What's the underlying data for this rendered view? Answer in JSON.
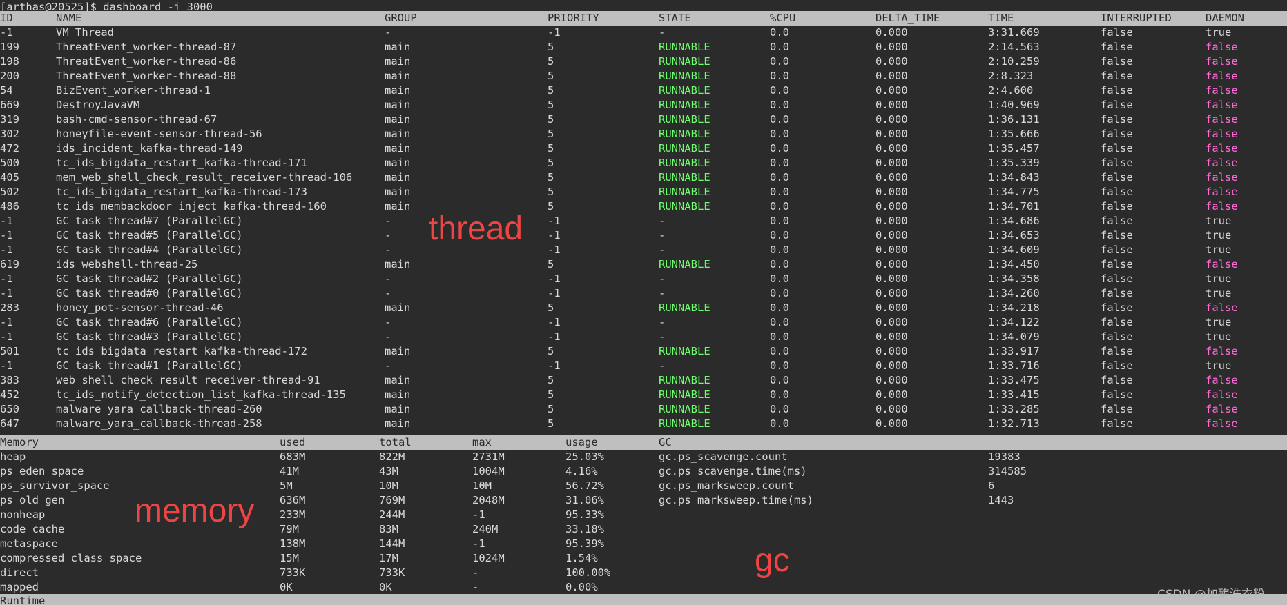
{
  "terminal": {
    "prompt": "[arthas@20525]$ dashboard -i 3000"
  },
  "thread_table": {
    "columns": [
      "ID",
      "NAME",
      "GROUP",
      "PRIORITY",
      "STATE",
      "%CPU",
      "DELTA_TIME",
      "TIME",
      "INTERRUPTED",
      "DAEMON"
    ],
    "rows": [
      [
        "-1",
        "VM Thread",
        "-",
        "-1",
        "-",
        "0.0",
        "0.000",
        "3:31.669",
        "false",
        "true"
      ],
      [
        "199",
        "ThreatEvent_worker-thread-87",
        "main",
        "5",
        "RUNNABLE",
        "0.0",
        "0.000",
        "2:14.563",
        "false",
        "false"
      ],
      [
        "198",
        "ThreatEvent_worker-thread-86",
        "main",
        "5",
        "RUNNABLE",
        "0.0",
        "0.000",
        "2:10.259",
        "false",
        "false"
      ],
      [
        "200",
        "ThreatEvent_worker-thread-88",
        "main",
        "5",
        "RUNNABLE",
        "0.0",
        "0.000",
        "2:8.323",
        "false",
        "false"
      ],
      [
        "54",
        "BizEvent_worker-thread-1",
        "main",
        "5",
        "RUNNABLE",
        "0.0",
        "0.000",
        "2:4.600",
        "false",
        "false"
      ],
      [
        "669",
        "DestroyJavaVM",
        "main",
        "5",
        "RUNNABLE",
        "0.0",
        "0.000",
        "1:40.969",
        "false",
        "false"
      ],
      [
        "319",
        "bash-cmd-sensor-thread-67",
        "main",
        "5",
        "RUNNABLE",
        "0.0",
        "0.000",
        "1:36.131",
        "false",
        "false"
      ],
      [
        "302",
        "honeyfile-event-sensor-thread-56",
        "main",
        "5",
        "RUNNABLE",
        "0.0",
        "0.000",
        "1:35.666",
        "false",
        "false"
      ],
      [
        "472",
        "ids_incident_kafka-thread-149",
        "main",
        "5",
        "RUNNABLE",
        "0.0",
        "0.000",
        "1:35.457",
        "false",
        "false"
      ],
      [
        "500",
        "tc_ids_bigdata_restart_kafka-thread-171",
        "main",
        "5",
        "RUNNABLE",
        "0.0",
        "0.000",
        "1:35.339",
        "false",
        "false"
      ],
      [
        "405",
        "mem_web_shell_check_result_receiver-thread-106",
        "main",
        "5",
        "RUNNABLE",
        "0.0",
        "0.000",
        "1:34.843",
        "false",
        "false"
      ],
      [
        "502",
        "tc_ids_bigdata_restart_kafka-thread-173",
        "main",
        "5",
        "RUNNABLE",
        "0.0",
        "0.000",
        "1:34.775",
        "false",
        "false"
      ],
      [
        "486",
        "tc_ids_membackdoor_inject_kafka-thread-160",
        "main",
        "5",
        "RUNNABLE",
        "0.0",
        "0.000",
        "1:34.701",
        "false",
        "false"
      ],
      [
        "-1",
        "GC task thread#7 (ParallelGC)",
        "-",
        "-1",
        "-",
        "0.0",
        "0.000",
        "1:34.686",
        "false",
        "true"
      ],
      [
        "-1",
        "GC task thread#5 (ParallelGC)",
        "-",
        "-1",
        "-",
        "0.0",
        "0.000",
        "1:34.653",
        "false",
        "true"
      ],
      [
        "-1",
        "GC task thread#4 (ParallelGC)",
        "-",
        "-1",
        "-",
        "0.0",
        "0.000",
        "1:34.609",
        "false",
        "true"
      ],
      [
        "619",
        "ids_webshell-thread-25",
        "main",
        "5",
        "RUNNABLE",
        "0.0",
        "0.000",
        "1:34.450",
        "false",
        "false"
      ],
      [
        "-1",
        "GC task thread#2 (ParallelGC)",
        "-",
        "-1",
        "-",
        "0.0",
        "0.000",
        "1:34.358",
        "false",
        "true"
      ],
      [
        "-1",
        "GC task thread#0 (ParallelGC)",
        "-",
        "-1",
        "-",
        "0.0",
        "0.000",
        "1:34.260",
        "false",
        "true"
      ],
      [
        "283",
        "honey_pot-sensor-thread-46",
        "main",
        "5",
        "RUNNABLE",
        "0.0",
        "0.000",
        "1:34.218",
        "false",
        "false"
      ],
      [
        "-1",
        "GC task thread#6 (ParallelGC)",
        "-",
        "-1",
        "-",
        "0.0",
        "0.000",
        "1:34.122",
        "false",
        "true"
      ],
      [
        "-1",
        "GC task thread#3 (ParallelGC)",
        "-",
        "-1",
        "-",
        "0.0",
        "0.000",
        "1:34.079",
        "false",
        "true"
      ],
      [
        "501",
        "tc_ids_bigdata_restart_kafka-thread-172",
        "main",
        "5",
        "RUNNABLE",
        "0.0",
        "0.000",
        "1:33.917",
        "false",
        "false"
      ],
      [
        "-1",
        "GC task thread#1 (ParallelGC)",
        "-",
        "-1",
        "-",
        "0.0",
        "0.000",
        "1:33.716",
        "false",
        "true"
      ],
      [
        "383",
        "web_shell_check_result_receiver-thread-91",
        "main",
        "5",
        "RUNNABLE",
        "0.0",
        "0.000",
        "1:33.475",
        "false",
        "false"
      ],
      [
        "452",
        "tc_ids_notify_detection_list_kafka-thread-135",
        "main",
        "5",
        "RUNNABLE",
        "0.0",
        "0.000",
        "1:33.415",
        "false",
        "false"
      ],
      [
        "650",
        "malware_yara_callback-thread-260",
        "main",
        "5",
        "RUNNABLE",
        "0.0",
        "0.000",
        "1:33.285",
        "false",
        "false"
      ],
      [
        "647",
        "malware_yara_callback-thread-258",
        "main",
        "5",
        "RUNNABLE",
        "0.0",
        "0.000",
        "1:32.713",
        "false",
        "false"
      ]
    ]
  },
  "memory_table": {
    "columns": [
      "Memory",
      "used",
      "total",
      "max",
      "usage"
    ],
    "rows": [
      [
        "heap",
        "683M",
        "822M",
        "2731M",
        "25.03%"
      ],
      [
        "ps_eden_space",
        "41M",
        "43M",
        "1004M",
        "4.16%"
      ],
      [
        "ps_survivor_space",
        "5M",
        "10M",
        "10M",
        "56.72%"
      ],
      [
        "ps_old_gen",
        "636M",
        "769M",
        "2048M",
        "31.06%"
      ],
      [
        "nonheap",
        "233M",
        "244M",
        "-1",
        "95.33%"
      ],
      [
        "code_cache",
        "79M",
        "83M",
        "240M",
        "33.18%"
      ],
      [
        "metaspace",
        "138M",
        "144M",
        "-1",
        "95.39%"
      ],
      [
        "compressed_class_space",
        "15M",
        "17M",
        "1024M",
        "1.54%"
      ],
      [
        "direct",
        "733K",
        "733K",
        "-",
        "100.00%"
      ],
      [
        "mapped",
        "0K",
        "0K",
        "-",
        "0.00%"
      ]
    ]
  },
  "gc_table": {
    "header": "GC",
    "rows": [
      [
        "gc.ps_scavenge.count",
        "19383"
      ],
      [
        "gc.ps_scavenge.time(ms)",
        "314585"
      ],
      [
        "gc.ps_marksweep.count",
        "6"
      ],
      [
        "gc.ps_marksweep.time(ms)",
        "1443"
      ]
    ]
  },
  "runtime_header": "Runtime",
  "annotations": {
    "thread": "thread",
    "memory": "memory",
    "gc": "gc"
  },
  "watermark": "CSDN @加酶洗衣粉",
  "colors": {
    "runnable": "#6dff6d",
    "daemon_false": "#ff6ad5",
    "annotation": "#ef4444",
    "header_bar": "#bfbfbf",
    "background": "#2b2b2b"
  }
}
